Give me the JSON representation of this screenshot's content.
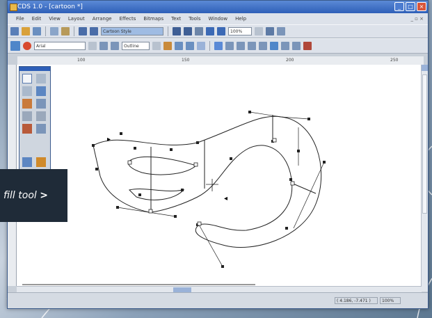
{
  "window": {
    "title": "CDS 1.0 - [cartoon *]"
  },
  "menu": [
    "File",
    "Edit",
    "View",
    "Layout",
    "Arrange",
    "Effects",
    "Bitmaps",
    "Text",
    "Tools",
    "Window",
    "Help"
  ],
  "toolbar": {
    "style_field": "Cartoon Style",
    "zoom_value": "100%",
    "font_field": "Arial",
    "size_field": "Outline"
  },
  "ruler_labels": [
    "100",
    "150",
    "200",
    "250"
  ],
  "status": {
    "coords": "( 4.186, -7.471 )",
    "zoom": "100%"
  },
  "callout": {
    "text": "fill tool",
    "marker": ">"
  },
  "colors": {
    "title_bar": "#2e5fb8",
    "callout_bg": "#1f2b38",
    "accent": "#d8553a"
  },
  "icons": [
    "pick-tool-icon",
    "shape-tool-icon",
    "zoom-tool-icon",
    "freehand-tool-icon",
    "rectangle-tool-icon",
    "ellipse-tool-icon",
    "text-tool-icon",
    "fill-tool-icon"
  ]
}
